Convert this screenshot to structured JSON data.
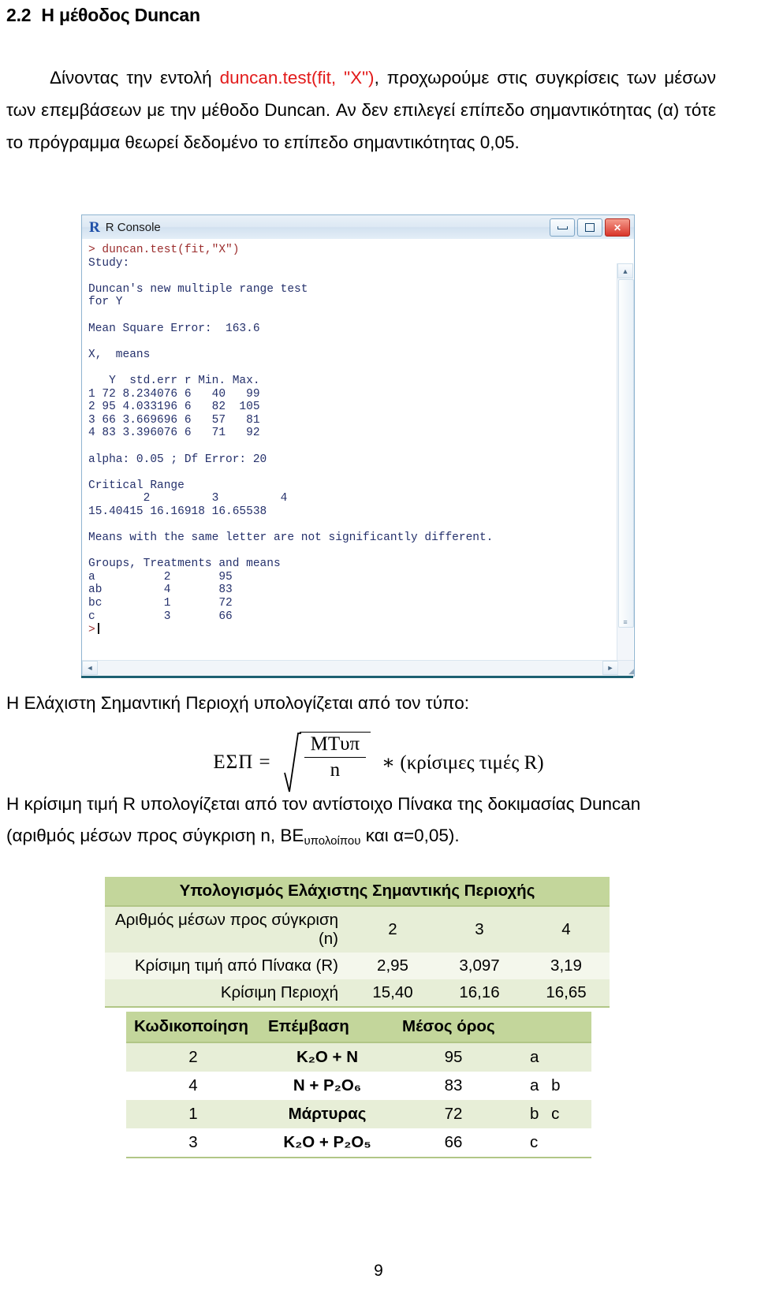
{
  "heading": {
    "number": "2.2",
    "title": "Η μέθοδος Duncan"
  },
  "paragraph": {
    "part1": "Δίνοντας την εντολή ",
    "code": "duncan.test(fit, \"Χ\")",
    "part2": ", προχωρούμε στις συγκρίσεις των μέσων των επεμβάσεων με την μέθοδο Duncan. Αν δεν επιλεγεί επίπεδο σημαντικότητας (α) τότε το πρόγραμμα θεωρεί δεδομένο το επίπεδο σημαντικότητας 0,05."
  },
  "rconsole": {
    "window_title": "R Console",
    "logo": "R",
    "minimize_label": "minimize",
    "maximize_label": "maximize",
    "close_label": "✕",
    "command_line": "> duncan.test(fit,\"X\")",
    "output": "\nStudy:\n\nDuncan's new multiple range test\nfor Y\n\nMean Square Error:  163.6\n\nX,  means\n\n   Y  std.err r Min. Max.\n1 72 8.234076 6   40   99\n2 95 4.033196 6   82  105\n3 66 3.669696 6   57   81\n4 83 3.396076 6   71   92\n\nalpha: 0.05 ; Df Error: 20\n\nCritical Range\n        2         3         4\n15.40415 16.16918 16.65538\n\nMeans with the same letter are not significantly different.\n\nGroups, Treatments and means\na          2       95\nab         4       83\nbc         1       72\nc          3       66\n",
    "prompt": ">"
  },
  "midtext1": "Η Ελάχιστη Σημαντική Περιοχή υπολογίζεται από τον τύπο:",
  "formula": {
    "lhs": "ΕΣΠ =",
    "numerator": "ΜΤυπ",
    "denominator": "n",
    "rhs": "∗ (κρίσιμες τιμές R)"
  },
  "midtext2": {
    "line1": "Η κρίσιμη τιμή R υπολογίζεται από τον αντίστοιχο Πίνακα της δοκιμασίας Duncan",
    "line2_a": "(αριθμός μέσων προς σύγκριση n, ΒΕ",
    "line2_sub": "υπολοίπου",
    "line2_b": " και α=0,05)."
  },
  "table1": {
    "title": "Υπολογισμός Ελάχιστης Σημαντικής Περιοχής",
    "rows": [
      {
        "label": "Αριθμός μέσων προς σύγκριση (n)",
        "values": [
          "2",
          "3",
          "4"
        ]
      },
      {
        "label": "Κρίσιμη τιμή από Πίνακα (R)",
        "values": [
          "2,95",
          "3,097",
          "3,19"
        ]
      },
      {
        "label": "Κρίσιμη Περιοχή",
        "values": [
          "15,40",
          "16,16",
          "16,65"
        ]
      }
    ]
  },
  "table2": {
    "headers": [
      "Κωδικοποίηση",
      "Επέμβαση",
      "Μέσος όρος",
      ""
    ],
    "rows": [
      {
        "code": "2",
        "treatment": "K₂O + N",
        "mean": "95",
        "group": "a"
      },
      {
        "code": "4",
        "treatment": "N + P₂O₆",
        "mean": "83",
        "group": "a b"
      },
      {
        "code": "1",
        "treatment": "Μάρτυρας",
        "mean": "72",
        "group": "b c"
      },
      {
        "code": "3",
        "treatment": "K₂O + P₂O₅",
        "mean": "66",
        "group": "c"
      }
    ]
  },
  "page_number": "9",
  "colors": {
    "code_red": "#e21b1b",
    "table_header_green": "#c3d69b",
    "table_row_green": "#e7eed7",
    "window_border_blue": "#8fb4d0",
    "console_text": "#24306b"
  }
}
